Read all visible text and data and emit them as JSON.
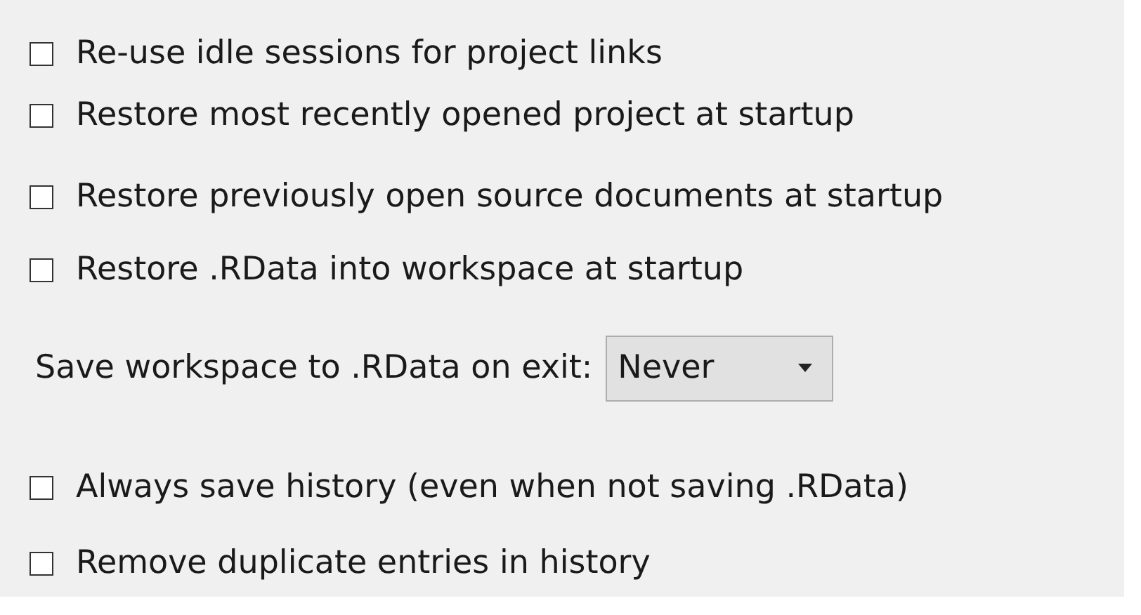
{
  "options": [
    {
      "kind": "checkbox",
      "label": "Re-use idle sessions for project links",
      "checked": false
    },
    {
      "kind": "checkbox",
      "label": "Restore most recently opened project at startup",
      "checked": false
    },
    {
      "kind": "checkbox",
      "label": "Restore previously open source documents at startup",
      "checked": false
    },
    {
      "kind": "checkbox",
      "label": "Restore .RData into workspace at startup",
      "checked": false
    },
    {
      "kind": "select",
      "label": "Save workspace to .RData on exit:",
      "value": "Never"
    },
    {
      "kind": "checkbox",
      "label": "Always save history (even when not saving .RData)",
      "checked": false
    },
    {
      "kind": "checkbox",
      "label": "Remove duplicate entries in history",
      "checked": false
    }
  ]
}
